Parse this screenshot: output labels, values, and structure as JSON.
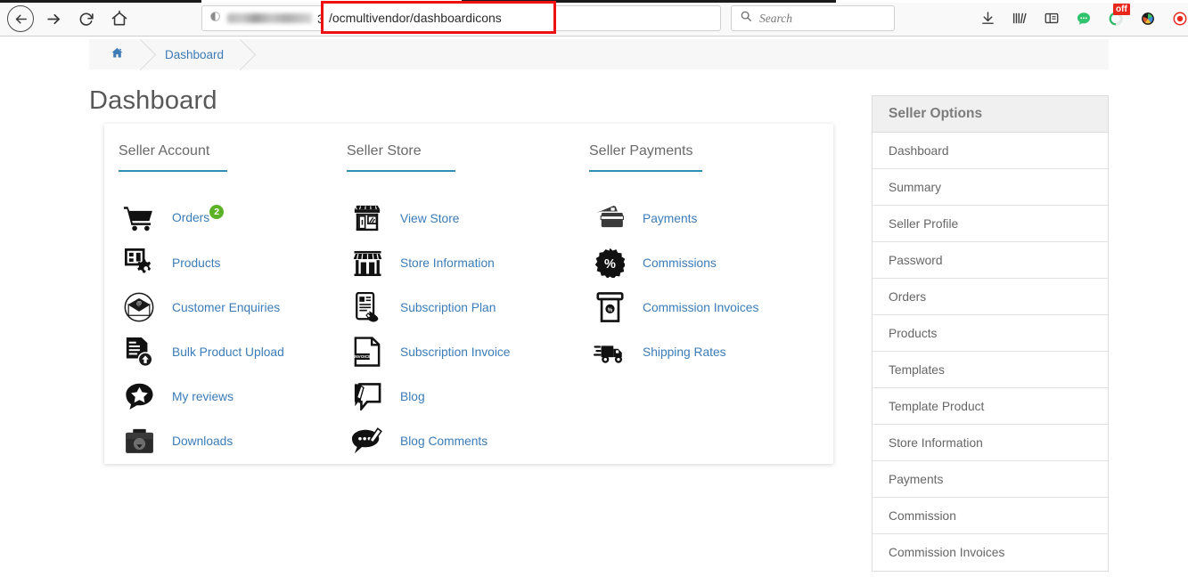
{
  "browser": {
    "nav": {
      "back_label": "Back",
      "forward_label": "Forward",
      "reload_label": "Reload",
      "home_label": "Home"
    },
    "url": {
      "prefix_visible": "3",
      "highlighted": "/ocmultivendor/dashboardicons",
      "domain_hidden": true
    },
    "search": {
      "placeholder": "Search",
      "value": ""
    },
    "toolbar_icons": [
      {
        "name": "downloads-icon",
        "label": "Downloads"
      },
      {
        "name": "library-icon",
        "label": "Library"
      },
      {
        "name": "sidebars-icon",
        "label": "Sidebars"
      },
      {
        "name": "chat-icon",
        "label": "Chat"
      },
      {
        "name": "extension-icon",
        "label": "Extension",
        "badge": "off"
      },
      {
        "name": "color-wheel-icon",
        "label": "Color Picker"
      },
      {
        "name": "record-icon",
        "label": "Record"
      }
    ]
  },
  "breadcrumb": {
    "home_icon": "home-icon",
    "items": [
      {
        "label": "Dashboard"
      }
    ]
  },
  "page": {
    "title": "Dashboard"
  },
  "card": {
    "columns": [
      {
        "heading": "Seller Account",
        "links": [
          {
            "label": "Orders",
            "icon": "shopping-cart-icon",
            "badge": "2"
          },
          {
            "label": "Products",
            "icon": "products-gear-icon"
          },
          {
            "label": "Customer Enquiries",
            "icon": "email-at-icon"
          },
          {
            "label": "Bulk Product Upload",
            "icon": "document-upload-icon"
          },
          {
            "label": "My reviews",
            "icon": "star-chat-icon"
          },
          {
            "label": "Downloads",
            "icon": "folder-download-icon"
          }
        ]
      },
      {
        "heading": "Seller Store",
        "links": [
          {
            "label": "View Store",
            "icon": "storefront-icon"
          },
          {
            "label": "Store Information",
            "icon": "shop-awning-icon"
          },
          {
            "label": "Subscription Plan",
            "icon": "mobile-signup-icon"
          },
          {
            "label": "Subscription Invoice",
            "icon": "invoice-icon"
          },
          {
            "label": "Blog",
            "icon": "blog-pencil-icon"
          },
          {
            "label": "Blog Comments",
            "icon": "comment-pencil-icon"
          }
        ]
      },
      {
        "heading": "Seller Payments",
        "links": [
          {
            "label": "Payments",
            "icon": "credit-card-icon"
          },
          {
            "label": "Commissions",
            "icon": "percent-badge-icon"
          },
          {
            "label": "Commission Invoices",
            "icon": "receipt-percent-icon"
          },
          {
            "label": "Shipping Rates",
            "icon": "delivery-truck-icon"
          }
        ]
      }
    ]
  },
  "sidebar": {
    "heading": "Seller Options",
    "items": [
      {
        "label": "Dashboard"
      },
      {
        "label": "Summary"
      },
      {
        "label": "Seller Profile"
      },
      {
        "label": "Password"
      },
      {
        "label": "Orders"
      },
      {
        "label": "Products"
      },
      {
        "label": "Templates"
      },
      {
        "label": "Template Product"
      },
      {
        "label": "Store Information"
      },
      {
        "label": "Payments"
      },
      {
        "label": "Commission"
      },
      {
        "label": "Commission Invoices"
      }
    ]
  },
  "colors": {
    "link_blue": "#3b7cb8",
    "heading_underline": "#2e8fb5",
    "badge_green": "#5cb226",
    "url_highlight_red": "#ee1111",
    "sidebar_header_bg": "#f0f0f0",
    "breadcrumb_bg": "#f7f7f7"
  }
}
